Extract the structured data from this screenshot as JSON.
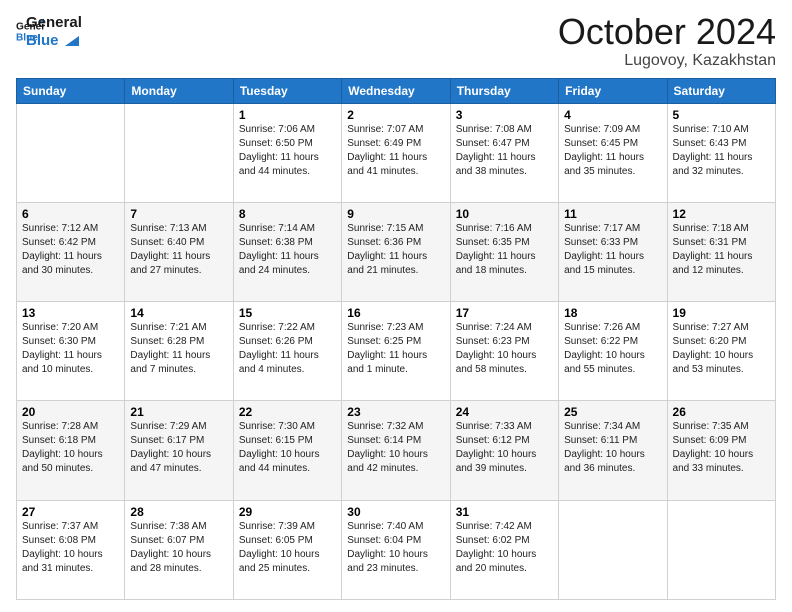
{
  "logo": {
    "line1": "General",
    "line2": "Blue"
  },
  "title": "October 2024",
  "location": "Lugovoy, Kazakhstan",
  "days_of_week": [
    "Sunday",
    "Monday",
    "Tuesday",
    "Wednesday",
    "Thursday",
    "Friday",
    "Saturday"
  ],
  "weeks": [
    [
      null,
      null,
      {
        "day": "1",
        "sunrise": "7:06 AM",
        "sunset": "6:50 PM",
        "daylight": "11 hours and 44 minutes."
      },
      {
        "day": "2",
        "sunrise": "7:07 AM",
        "sunset": "6:49 PM",
        "daylight": "11 hours and 41 minutes."
      },
      {
        "day": "3",
        "sunrise": "7:08 AM",
        "sunset": "6:47 PM",
        "daylight": "11 hours and 38 minutes."
      },
      {
        "day": "4",
        "sunrise": "7:09 AM",
        "sunset": "6:45 PM",
        "daylight": "11 hours and 35 minutes."
      },
      {
        "day": "5",
        "sunrise": "7:10 AM",
        "sunset": "6:43 PM",
        "daylight": "11 hours and 32 minutes."
      }
    ],
    [
      {
        "day": "6",
        "sunrise": "7:12 AM",
        "sunset": "6:42 PM",
        "daylight": "11 hours and 30 minutes."
      },
      {
        "day": "7",
        "sunrise": "7:13 AM",
        "sunset": "6:40 PM",
        "daylight": "11 hours and 27 minutes."
      },
      {
        "day": "8",
        "sunrise": "7:14 AM",
        "sunset": "6:38 PM",
        "daylight": "11 hours and 24 minutes."
      },
      {
        "day": "9",
        "sunrise": "7:15 AM",
        "sunset": "6:36 PM",
        "daylight": "11 hours and 21 minutes."
      },
      {
        "day": "10",
        "sunrise": "7:16 AM",
        "sunset": "6:35 PM",
        "daylight": "11 hours and 18 minutes."
      },
      {
        "day": "11",
        "sunrise": "7:17 AM",
        "sunset": "6:33 PM",
        "daylight": "11 hours and 15 minutes."
      },
      {
        "day": "12",
        "sunrise": "7:18 AM",
        "sunset": "6:31 PM",
        "daylight": "11 hours and 12 minutes."
      }
    ],
    [
      {
        "day": "13",
        "sunrise": "7:20 AM",
        "sunset": "6:30 PM",
        "daylight": "11 hours and 10 minutes."
      },
      {
        "day": "14",
        "sunrise": "7:21 AM",
        "sunset": "6:28 PM",
        "daylight": "11 hours and 7 minutes."
      },
      {
        "day": "15",
        "sunrise": "7:22 AM",
        "sunset": "6:26 PM",
        "daylight": "11 hours and 4 minutes."
      },
      {
        "day": "16",
        "sunrise": "7:23 AM",
        "sunset": "6:25 PM",
        "daylight": "11 hours and 1 minute."
      },
      {
        "day": "17",
        "sunrise": "7:24 AM",
        "sunset": "6:23 PM",
        "daylight": "10 hours and 58 minutes."
      },
      {
        "day": "18",
        "sunrise": "7:26 AM",
        "sunset": "6:22 PM",
        "daylight": "10 hours and 55 minutes."
      },
      {
        "day": "19",
        "sunrise": "7:27 AM",
        "sunset": "6:20 PM",
        "daylight": "10 hours and 53 minutes."
      }
    ],
    [
      {
        "day": "20",
        "sunrise": "7:28 AM",
        "sunset": "6:18 PM",
        "daylight": "10 hours and 50 minutes."
      },
      {
        "day": "21",
        "sunrise": "7:29 AM",
        "sunset": "6:17 PM",
        "daylight": "10 hours and 47 minutes."
      },
      {
        "day": "22",
        "sunrise": "7:30 AM",
        "sunset": "6:15 PM",
        "daylight": "10 hours and 44 minutes."
      },
      {
        "day": "23",
        "sunrise": "7:32 AM",
        "sunset": "6:14 PM",
        "daylight": "10 hours and 42 minutes."
      },
      {
        "day": "24",
        "sunrise": "7:33 AM",
        "sunset": "6:12 PM",
        "daylight": "10 hours and 39 minutes."
      },
      {
        "day": "25",
        "sunrise": "7:34 AM",
        "sunset": "6:11 PM",
        "daylight": "10 hours and 36 minutes."
      },
      {
        "day": "26",
        "sunrise": "7:35 AM",
        "sunset": "6:09 PM",
        "daylight": "10 hours and 33 minutes."
      }
    ],
    [
      {
        "day": "27",
        "sunrise": "7:37 AM",
        "sunset": "6:08 PM",
        "daylight": "10 hours and 31 minutes."
      },
      {
        "day": "28",
        "sunrise": "7:38 AM",
        "sunset": "6:07 PM",
        "daylight": "10 hours and 28 minutes."
      },
      {
        "day": "29",
        "sunrise": "7:39 AM",
        "sunset": "6:05 PM",
        "daylight": "10 hours and 25 minutes."
      },
      {
        "day": "30",
        "sunrise": "7:40 AM",
        "sunset": "6:04 PM",
        "daylight": "10 hours and 23 minutes."
      },
      {
        "day": "31",
        "sunrise": "7:42 AM",
        "sunset": "6:02 PM",
        "daylight": "10 hours and 20 minutes."
      },
      null,
      null
    ]
  ],
  "labels": {
    "sunrise": "Sunrise:",
    "sunset": "Sunset:",
    "daylight": "Daylight:"
  }
}
